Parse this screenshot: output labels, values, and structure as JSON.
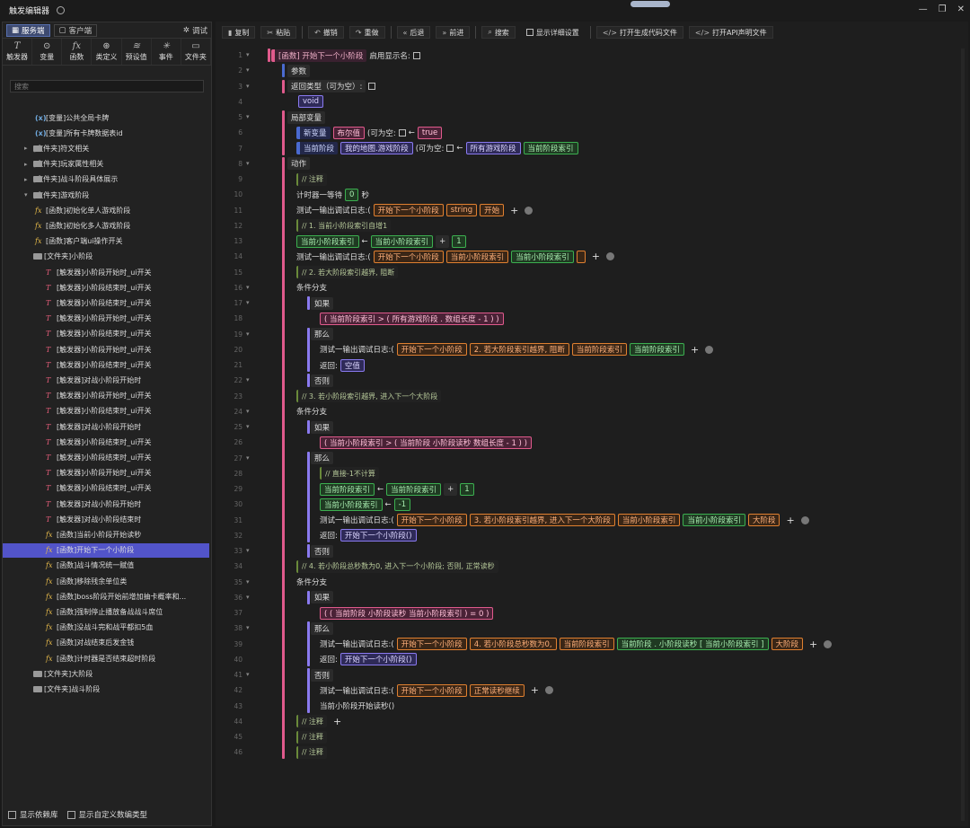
{
  "app": {
    "title": "触发编辑器"
  },
  "left": {
    "tabs": [
      "服务端",
      "客户端"
    ],
    "debug": "调试",
    "tools": [
      {
        "icon": "T",
        "label": "触发器"
      },
      {
        "icon": "⊙",
        "label": "变量"
      },
      {
        "icon": "fx",
        "label": "函数"
      },
      {
        "icon": "⊛",
        "label": "类定义"
      },
      {
        "icon": "≋",
        "label": "预设值"
      },
      {
        "icon": "✳",
        "label": "事件"
      },
      {
        "icon": "▭",
        "label": "文件夹"
      }
    ],
    "search_placeholder": "搜索",
    "tree": [
      {
        "type": "var",
        "label": "[变量]公共全局卡牌",
        "indent": 3
      },
      {
        "type": "var",
        "label": "[变量]所有卡牌数据表id",
        "indent": 3
      },
      {
        "type": "folder",
        "label": "[文件夹]符文相关",
        "indent": 2
      },
      {
        "type": "folder",
        "label": "[文件夹]玩家属性相关",
        "indent": 2
      },
      {
        "type": "folder",
        "label": "[文件夹]战斗阶段具体展示",
        "indent": 2
      },
      {
        "type": "folder-open",
        "label": "[文件夹]游戏阶段",
        "indent": 2
      },
      {
        "type": "fx",
        "label": "[函数]初始化单人游戏阶段",
        "indent": 3
      },
      {
        "type": "fx",
        "label": "[函数]初始化多人游戏阶段",
        "indent": 3
      },
      {
        "type": "fx",
        "label": "[函数]客户端ui操作开关",
        "indent": 3
      },
      {
        "type": "folder-open",
        "label": "[文件夹]小阶段",
        "indent": 3
      },
      {
        "type": "tr",
        "label": "[触发器]小阶段开始时_ui开关",
        "indent": 4
      },
      {
        "type": "tr",
        "label": "[触发器]小阶段结束时_ui开关",
        "indent": 4
      },
      {
        "type": "tr",
        "label": "[触发器]小阶段结束时_ui开关",
        "indent": 4
      },
      {
        "type": "tr",
        "label": "[触发器]小阶段开始时_ui开关",
        "indent": 4
      },
      {
        "type": "tr",
        "label": "[触发器]小阶段结束时_ui开关",
        "indent": 4
      },
      {
        "type": "tr",
        "label": "[触发器]小阶段开始时_ui开关",
        "indent": 4
      },
      {
        "type": "tr",
        "label": "[触发器]小阶段结束时_ui开关",
        "indent": 4
      },
      {
        "type": "tr",
        "label": "[触发器]对战小阶段开始时",
        "indent": 4
      },
      {
        "type": "tr",
        "label": "[触发器]小阶段开始时_ui开关",
        "indent": 4
      },
      {
        "type": "tr",
        "label": "[触发器]小阶段结束时_ui开关",
        "indent": 4
      },
      {
        "type": "tr",
        "label": "[触发器]对战小阶段开始时",
        "indent": 4
      },
      {
        "type": "tr",
        "label": "[触发器]小阶段结束时_ui开关",
        "indent": 4
      },
      {
        "type": "tr",
        "label": "[触发器]小阶段结束时_ui开关",
        "indent": 4
      },
      {
        "type": "tr",
        "label": "[触发器]小阶段开始时_ui开关",
        "indent": 4
      },
      {
        "type": "tr",
        "label": "[触发器]小阶段结束时_ui开关",
        "indent": 4
      },
      {
        "type": "tr",
        "label": "[触发器]对战小阶段开始时",
        "indent": 4
      },
      {
        "type": "tr",
        "label": "[触发器]对战小阶段结束时",
        "indent": 4
      },
      {
        "type": "fx",
        "label": "[函数]当前小阶段开始读秒",
        "indent": 4
      },
      {
        "type": "fx",
        "label": "[函数]开始下一个小阶段",
        "indent": 4,
        "selected": true
      },
      {
        "type": "fx",
        "label": "[函数]战斗情况统一赋值",
        "indent": 4
      },
      {
        "type": "fx",
        "label": "[函数]移除残余单位类",
        "indent": 4
      },
      {
        "type": "fx",
        "label": "[函数]boss阶段开始前增加抽卡概率和...",
        "indent": 4
      },
      {
        "type": "fx",
        "label": "[函数]强制停止播放备战战斗席位",
        "indent": 4
      },
      {
        "type": "fx",
        "label": "[函数]没战斗完和战平都扣5血",
        "indent": 4
      },
      {
        "type": "fx",
        "label": "[函数]对战结束后发金钱",
        "indent": 4
      },
      {
        "type": "fx",
        "label": "[函数]计时器是否结束超时阶段",
        "indent": 4
      },
      {
        "type": "folder",
        "label": "[文件夹]大阶段",
        "indent": 3
      },
      {
        "type": "folder-open",
        "label": "[文件夹]战斗阶段",
        "indent": 3
      }
    ],
    "bottom": [
      "显示依赖库",
      "显示自定义数编类型"
    ]
  },
  "toolbar": {
    "copy": "复制",
    "paste": "粘贴",
    "undo": "撤销",
    "redo": "重做",
    "back": "后退",
    "forward": "前进",
    "search": "搜索",
    "detail": "显示详细设置",
    "gen_code": "打开生成代码文件",
    "api_doc": "打开API声明文件"
  },
  "code": {
    "l1_func": "[函数]",
    "l1_name": "开始下一个小阶段",
    "l1_show": "启用显示名:",
    "l2": "参数",
    "l3": "返回类型（可为空）:",
    "l4": "void",
    "l5": "局部变量",
    "l6_name": "新变量",
    "l6_type": "布尔值",
    "l6_null": "(可为空:",
    "l6_val": "true",
    "l7_name": "当前阶段",
    "l7_type": "我的地图.游戏阶段",
    "l7_null": "(可为空:",
    "l7_val": "所有游戏阶段",
    "l7_idx": "当前阶段索引",
    "l8": "动作",
    "l9": "注释",
    "l10_a": "计时器一等待",
    "l10_n": "0",
    "l10_b": "秒",
    "log": "测试一输出调试日志:(",
    "l11": [
      "开始下一个小阶段",
      "string",
      "开始"
    ],
    "l12": "1. 当前小阶段索引自增1",
    "l13_a": "当前小阶段索引",
    "l13_b": "当前小阶段索引",
    "l13_op": "+",
    "l13_n": "1",
    "l14": [
      "开始下一个小阶段",
      "当前小阶段索引",
      "当前小阶段索引"
    ],
    "l15": "2. 若大阶段索引越界, 阻断",
    "branch": "条件分支",
    "if": "如果",
    "then": "那么",
    "else": "否则",
    "l18": [
      "当前阶段索引",
      ">",
      "所有游戏阶段",
      "数组长度",
      "-",
      "1"
    ],
    "l20": [
      "开始下一个小阶段",
      "2. 若大阶段索引越界, 阻断",
      "当前阶段索引",
      "当前阶段索引"
    ],
    "ret": "返回:",
    "l21": "空值",
    "l23": "3. 若小阶段索引越界, 进入下一个大阶段",
    "l26": [
      "当前小阶段索引",
      ">",
      "当前阶段",
      "小阶段读秒",
      "数组长度",
      "-",
      "1"
    ],
    "l28": "直接-1不计算",
    "l29": [
      "当前阶段索引",
      "当前阶段索引",
      "+",
      "1"
    ],
    "l30": [
      "当前小阶段索引",
      "-1"
    ],
    "l31": [
      "开始下一个小阶段",
      "3. 若小阶段索引越界, 进入下一个大阶段",
      "当前小阶段索引",
      "当前小阶段索引",
      "大阶段"
    ],
    "l32": "开始下一个小阶段()",
    "l34": "4. 若小阶段总秒数为0, 进入下一个小阶段; 否则, 正常读秒",
    "l37": [
      "当前阶段",
      "小阶段读秒",
      "当前小阶段索引",
      "=",
      "0"
    ],
    "l39": [
      "开始下一个小阶段",
      "4. 若小阶段总秒数为0,",
      "当前阶段索引",
      "当前阶段",
      "小阶段读秒",
      "当前小阶段索引",
      "大阶段"
    ],
    "l40": "开始下一个小阶段()",
    "l42": [
      "开始下一个小阶段",
      "正常读秒继续"
    ],
    "l43": "当前小阶段开始读秒()",
    "comment": "注释"
  }
}
